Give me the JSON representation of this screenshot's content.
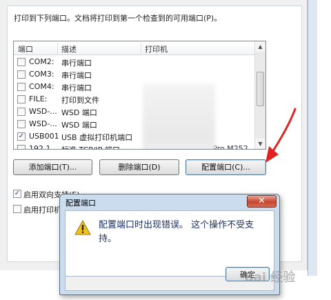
{
  "intro_text": "打印到下列端口。文档将打印到第一个检查到的可用端口(P)。",
  "columns": {
    "port": "端口",
    "description": "描述",
    "printer": "打印机"
  },
  "ports": [
    {
      "checked": false,
      "port": "COM2:",
      "description": "串行端口",
      "printer": ""
    },
    {
      "checked": false,
      "port": "COM3:",
      "description": "串行端口",
      "printer": ""
    },
    {
      "checked": false,
      "port": "COM4:",
      "description": "串行端口",
      "printer": ""
    },
    {
      "checked": false,
      "port": "FILE:",
      "description": "打印到文件",
      "printer": ""
    },
    {
      "checked": false,
      "port": "WSD-...",
      "description": "WSD 端口",
      "printer": ""
    },
    {
      "checked": false,
      "port": "WSD-...",
      "description": "WSD 端口",
      "printer": ""
    },
    {
      "checked": true,
      "port": "USB001",
      "description": "USB 虚拟打印机端口",
      "printer": ""
    },
    {
      "checked": false,
      "port": "192.1...",
      "description": "标准 TCP/IP 端口",
      "printer": "HP Color LaserJet Pro M252"
    }
  ],
  "buttons": {
    "add_port": "添加端口(T)...",
    "delete_port": "删除端口(D)",
    "configure_port": "配置端口(C)..."
  },
  "options": {
    "bidirectional": {
      "label": "启用双向支持(E)",
      "checked": true
    },
    "pooling": {
      "label": "启用打印机池(N)",
      "checked": false
    }
  },
  "dialog": {
    "title": "配置端口",
    "message": "配置端口时出现错误。 这个操作不受支持。",
    "ok_label": "确定",
    "close_glyph": "✕"
  },
  "checkmark_glyph": "✓",
  "watermark": "Bai 经验",
  "colors": {
    "arrow": "#e0231f",
    "dialog_text": "#1b2f63",
    "close_button": "#c6452f"
  },
  "icons": {
    "warning": "warning-icon",
    "arrow": "red-arrow-annotation"
  }
}
